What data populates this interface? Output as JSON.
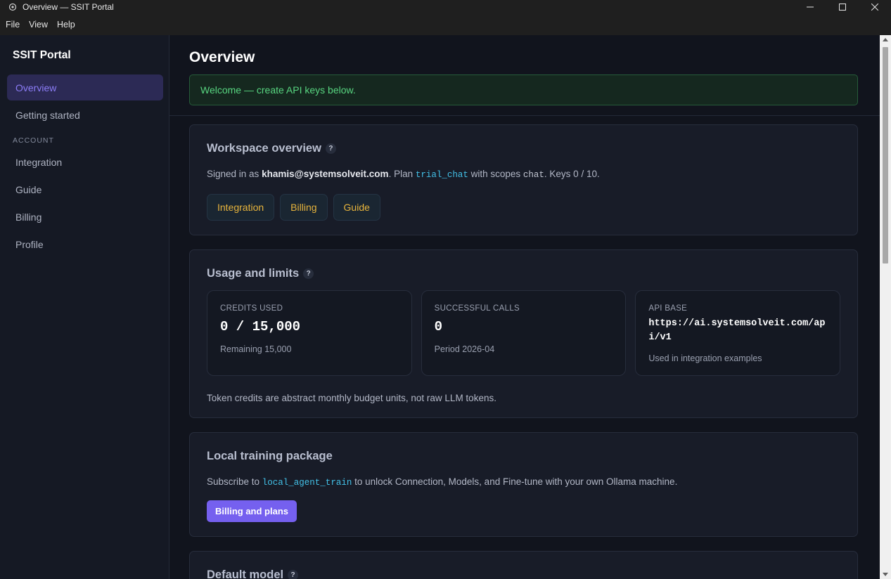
{
  "window": {
    "title": "Overview — SSIT Portal",
    "minimize": "—",
    "maximize": "☐",
    "close": "✕"
  },
  "menu": [
    "File",
    "View",
    "Help"
  ],
  "sidebar": {
    "brand": "SSIT Portal",
    "items_top": [
      {
        "label": "Overview",
        "active": true
      },
      {
        "label": "Getting started",
        "active": false
      }
    ],
    "section_label": "ACCOUNT",
    "items_account": [
      {
        "label": "Integration"
      },
      {
        "label": "Guide"
      },
      {
        "label": "Billing"
      },
      {
        "label": "Profile"
      }
    ]
  },
  "header": {
    "title": "Overview",
    "alert": "Welcome — create API keys below."
  },
  "workspace": {
    "title": "Workspace overview",
    "help": "?",
    "signed_in_prefix": "Signed in as ",
    "email": "khamis@systemsolveit.com",
    "plan_prefix": ". Plan ",
    "plan": "trial_chat",
    "scopes_prefix": " with scopes ",
    "scope": "chat",
    "keys_text": ". Keys 0 / 10.",
    "buttons": [
      "Integration",
      "Billing",
      "Guide"
    ]
  },
  "usage": {
    "title": "Usage and limits",
    "help": "?",
    "stats": [
      {
        "label": "CREDITS USED",
        "value": "0 / 15,000",
        "sub": "Remaining 15,000"
      },
      {
        "label": "SUCCESSFUL CALLS",
        "value": "0",
        "sub": "Period 2026-04"
      },
      {
        "label": "API BASE",
        "value": "https://ai.systemsolveit.com/api/v1",
        "sub": "Used in integration examples"
      }
    ],
    "note": "Token credits are abstract monthly budget units, not raw LLM tokens."
  },
  "local_training": {
    "title": "Local training package",
    "text_prefix": "Subscribe to ",
    "package": "local_agent_train",
    "text_suffix": " to unlock Connection, Models, and Fine-tune with your own Ollama machine.",
    "button": "Billing and plans"
  },
  "default_model": {
    "title": "Default model",
    "help": "?"
  },
  "colors": {
    "accent": "#7560ef",
    "active_nav": "#8b7cf6",
    "success": "#58d580",
    "link_mono": "#43c1e8",
    "soft_button_text": "#e7b43c"
  }
}
